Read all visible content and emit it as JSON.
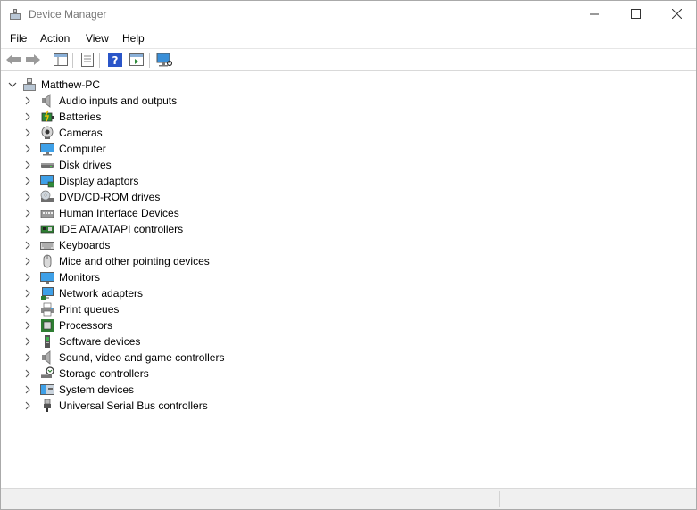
{
  "window": {
    "title": "Device Manager"
  },
  "controls": {
    "minimize": "minimize-icon",
    "maximize": "maximize-icon",
    "close": "close-icon"
  },
  "menu": [
    "File",
    "Action",
    "View",
    "Help"
  ],
  "toolbar": {
    "buttons": [
      "back-arrow-icon",
      "forward-arrow-icon",
      "show-hide-console-tree-icon",
      "properties-icon",
      "help-icon",
      "action-pane-icon",
      "scan-hardware-icon"
    ]
  },
  "tree": {
    "root": "Matthew-PC",
    "items": [
      {
        "label": "Audio inputs and outputs",
        "icon": "speaker-icon"
      },
      {
        "label": "Batteries",
        "icon": "battery-icon"
      },
      {
        "label": "Cameras",
        "icon": "camera-icon"
      },
      {
        "label": "Computer",
        "icon": "computer-icon"
      },
      {
        "label": "Disk drives",
        "icon": "disk-drive-icon"
      },
      {
        "label": "Display adaptors",
        "icon": "display-adapter-icon"
      },
      {
        "label": "DVD/CD-ROM drives",
        "icon": "dvd-drive-icon"
      },
      {
        "label": "Human Interface Devices",
        "icon": "hid-icon"
      },
      {
        "label": "IDE ATA/ATAPI controllers",
        "icon": "ide-controller-icon"
      },
      {
        "label": "Keyboards",
        "icon": "keyboard-icon"
      },
      {
        "label": "Mice and other pointing devices",
        "icon": "mouse-icon"
      },
      {
        "label": "Monitors",
        "icon": "monitor-icon"
      },
      {
        "label": "Network adapters",
        "icon": "network-adapter-icon"
      },
      {
        "label": "Print queues",
        "icon": "printer-icon"
      },
      {
        "label": "Processors",
        "icon": "processor-icon"
      },
      {
        "label": "Software devices",
        "icon": "software-device-icon"
      },
      {
        "label": "Sound, video and game controllers",
        "icon": "sound-controller-icon"
      },
      {
        "label": "Storage controllers",
        "icon": "storage-controller-icon"
      },
      {
        "label": "System devices",
        "icon": "system-device-icon"
      },
      {
        "label": "Universal Serial Bus controllers",
        "icon": "usb-icon"
      }
    ]
  },
  "colors": {
    "title_text": "#777777",
    "status_bg": "#f0f0f0",
    "accent_blue": "#1e78d2"
  }
}
